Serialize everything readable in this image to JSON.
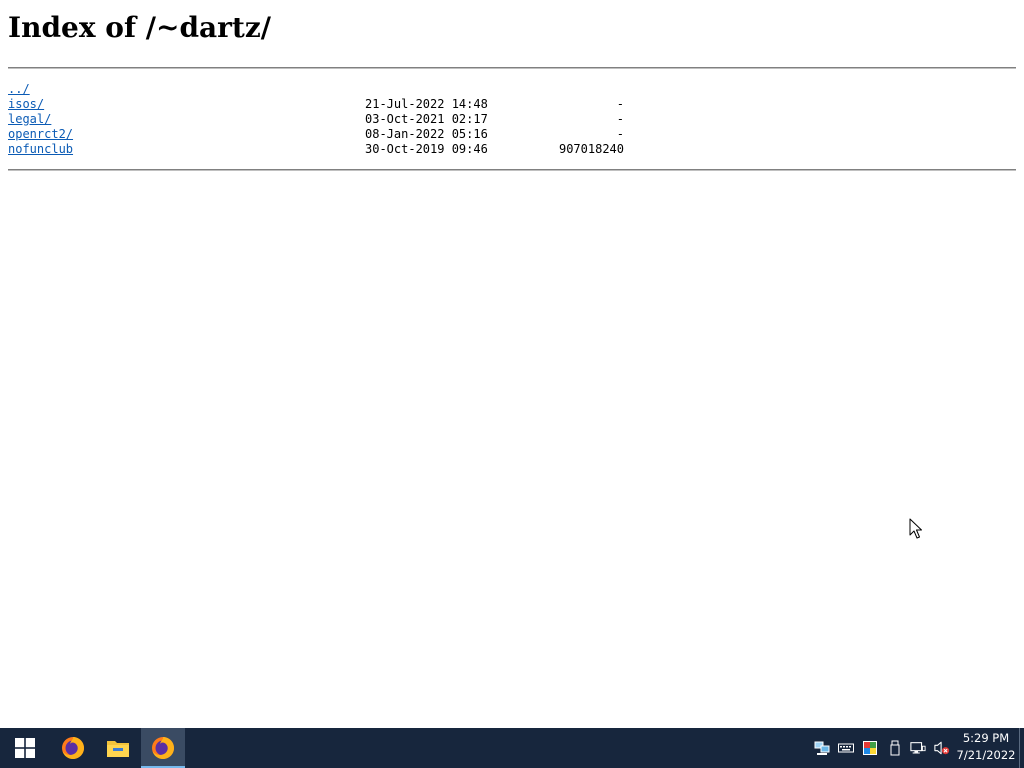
{
  "page": {
    "title": "Index of /~dartz/"
  },
  "listing": {
    "entries": [
      {
        "name": "../",
        "date": "",
        "size": ""
      },
      {
        "name": "isos/",
        "date": "21-Jul-2022 14:48",
        "size": "-"
      },
      {
        "name": "legal/",
        "date": "03-Oct-2021 02:17",
        "size": "-"
      },
      {
        "name": "openrct2/",
        "date": "08-Jan-2022 05:16",
        "size": "-"
      },
      {
        "name": "nofunclub",
        "date": "30-Oct-2019 09:46",
        "size": "907018240"
      }
    ]
  },
  "taskbar": {
    "start_icon": "windows-logo-icon",
    "pinned": [
      {
        "icon": "firefox-icon",
        "active": false
      },
      {
        "icon": "file-explorer-icon",
        "active": false
      },
      {
        "icon": "firefox-icon",
        "active": true
      }
    ],
    "tray_icons": [
      "network-computer-icon",
      "keyboard-icon",
      "color-palette-icon",
      "usb-drive-icon",
      "network-icon",
      "volume-muted-icon"
    ],
    "clock": {
      "time": "5:29 PM",
      "date": "7/21/2022"
    }
  },
  "colors": {
    "link": "#0b5bb5",
    "taskbar": "#17263d",
    "active_indicator": "#76b9ed"
  }
}
